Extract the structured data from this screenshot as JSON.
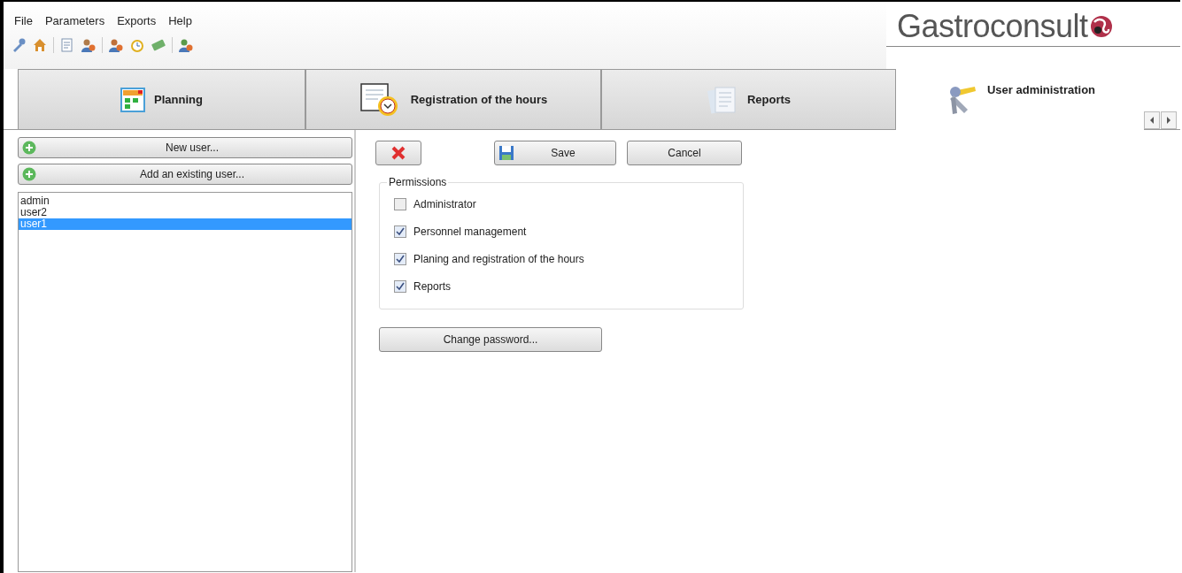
{
  "menu": [
    "File",
    "Parameters",
    "Exports",
    "Help"
  ],
  "logo": "Gastroconsult",
  "tabs": [
    {
      "label": "Planning",
      "kind": "calendar",
      "selected": false
    },
    {
      "label": "Registration of the hours",
      "kind": "clock",
      "selected": false
    },
    {
      "label": "Reports",
      "kind": "documents",
      "selected": false
    },
    {
      "label": "User administration",
      "kind": "keys",
      "selected": true
    }
  ],
  "user_buttons": [
    "New user...",
    "Add an existing user..."
  ],
  "users": [
    {
      "name": "admin",
      "selected": false
    },
    {
      "name": "user2",
      "selected": false
    },
    {
      "name": "user1",
      "selected": true
    }
  ],
  "actions": {
    "save": "Save",
    "cancel": "Cancel"
  },
  "permissions": {
    "title": "Permissions",
    "items": [
      {
        "label": "Administrator",
        "checked": false
      },
      {
        "label": "Personnel management",
        "checked": true
      },
      {
        "label": "Planing and registration of the hours",
        "checked": true
      },
      {
        "label": "Reports",
        "checked": true
      }
    ]
  },
  "change_password": "Change password..."
}
